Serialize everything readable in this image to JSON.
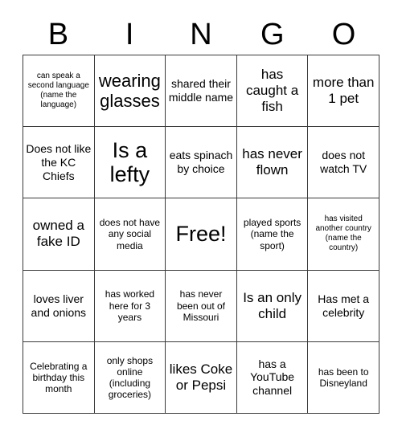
{
  "card": {
    "title": "BINGO",
    "header_letters": [
      "B",
      "I",
      "N",
      "G",
      "O"
    ],
    "colors": {
      "background": "#ffffff",
      "text": "#000000",
      "border": "#3a3a3a"
    },
    "grid_size": "5x5",
    "free_space_index": 12,
    "squares": [
      {
        "text": "can speak a second language (name the language)",
        "size": "xs"
      },
      {
        "text": "wearing glasses",
        "size": "xl"
      },
      {
        "text": "shared their middle name",
        "size": "md"
      },
      {
        "text": "has caught a fish",
        "size": "lg"
      },
      {
        "text": "more than 1 pet",
        "size": "lg"
      },
      {
        "text": "Does not like the KC Chiefs",
        "size": "md"
      },
      {
        "text": "Is a lefty",
        "size": "xxl"
      },
      {
        "text": "eats spinach by choice",
        "size": "md"
      },
      {
        "text": "has never flown",
        "size": "lg"
      },
      {
        "text": "does not watch TV",
        "size": "md"
      },
      {
        "text": "owned a fake ID",
        "size": "lg"
      },
      {
        "text": "does not have any social media",
        "size": "sm"
      },
      {
        "text": "Free!",
        "size": "xxl"
      },
      {
        "text": "played sports (name the sport)",
        "size": "sm"
      },
      {
        "text": "has visited another country (name the country)",
        "size": "xs"
      },
      {
        "text": "loves liver and onions",
        "size": "md"
      },
      {
        "text": "has worked here for 3 years",
        "size": "sm"
      },
      {
        "text": "has never been out of Missouri",
        "size": "sm"
      },
      {
        "text": "Is an only child",
        "size": "lg"
      },
      {
        "text": "Has met a celebrity",
        "size": "md"
      },
      {
        "text": "Celebrating a birthday this month",
        "size": "sm"
      },
      {
        "text": "only shops online (including groceries)",
        "size": "sm"
      },
      {
        "text": "likes Coke or Pepsi",
        "size": "lg"
      },
      {
        "text": "has a YouTube channel",
        "size": "md"
      },
      {
        "text": "has been to Disneyland",
        "size": "sm"
      }
    ]
  }
}
